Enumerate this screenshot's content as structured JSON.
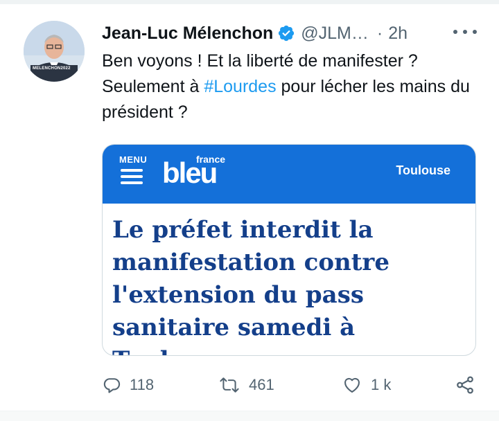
{
  "tweet": {
    "author_name": "Jean-Luc Mélenchon",
    "handle": "@JLM…",
    "separator": "·",
    "time": "2h",
    "avatar_banner": "MELENCHON2022",
    "text_part1": "Ben voyons ! Et la liberté de manifester ? Seulement à ",
    "hashtag": "#Lourdes",
    "text_part2": " pour lécher les mains du président ?"
  },
  "card": {
    "menu_label": "MENU",
    "brand_small": "france",
    "brand_large": "bleu",
    "region": "Toulouse",
    "headline": "Le préfet interdit la manifestation contre l'extension du pass sanitaire samedi à Toulouse"
  },
  "actions": {
    "replies": "118",
    "retweets": "461",
    "likes": "1 k"
  },
  "colors": {
    "accent": "#1d9bf0",
    "card_header": "#1470d9",
    "headline": "#143f8a",
    "muted": "#536471"
  },
  "icons": [
    "verified-badge-icon",
    "more-options-icon",
    "reply-icon",
    "retweet-icon",
    "like-icon",
    "share-icon",
    "menu-icon"
  ]
}
